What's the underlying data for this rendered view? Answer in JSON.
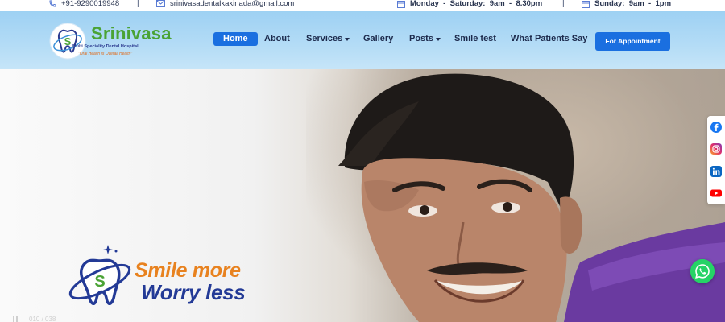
{
  "topbar": {
    "phone": "+91-9290019948",
    "email": "srinivasadentalkakinada@gmail.com",
    "hours_weekday": "Monday  -  Saturday:  9am  -  8.30pm",
    "hours_sunday": "Sunday:  9am  -  1pm",
    "separator": "|"
  },
  "logo": {
    "name": "Srinivasa",
    "subtitle": "Multi Speciality Dental Hospital",
    "tagline": "\"Oral Health Is Overall Health\"",
    "mark_letter": "S"
  },
  "nav": {
    "items": [
      {
        "label": "Home"
      },
      {
        "label": "About"
      },
      {
        "label": "Services"
      },
      {
        "label": "Gallery"
      },
      {
        "label": "Posts"
      },
      {
        "label": "Smile test"
      },
      {
        "label": "What Patients Say"
      }
    ],
    "cta": "For Appointment"
  },
  "hero": {
    "slogan_line1": "Smile more",
    "slogan_line2": "Worry less",
    "slide_counter": "010 / 038"
  },
  "social": [
    "facebook-icon",
    "instagram-icon",
    "linkedin-icon",
    "youtube-icon"
  ],
  "colors": {
    "accent": "#1a6fe0",
    "brand_green": "#4aa335",
    "brand_orange": "#e8821f",
    "brand_navy": "#233a96",
    "whatsapp": "#25d366"
  }
}
